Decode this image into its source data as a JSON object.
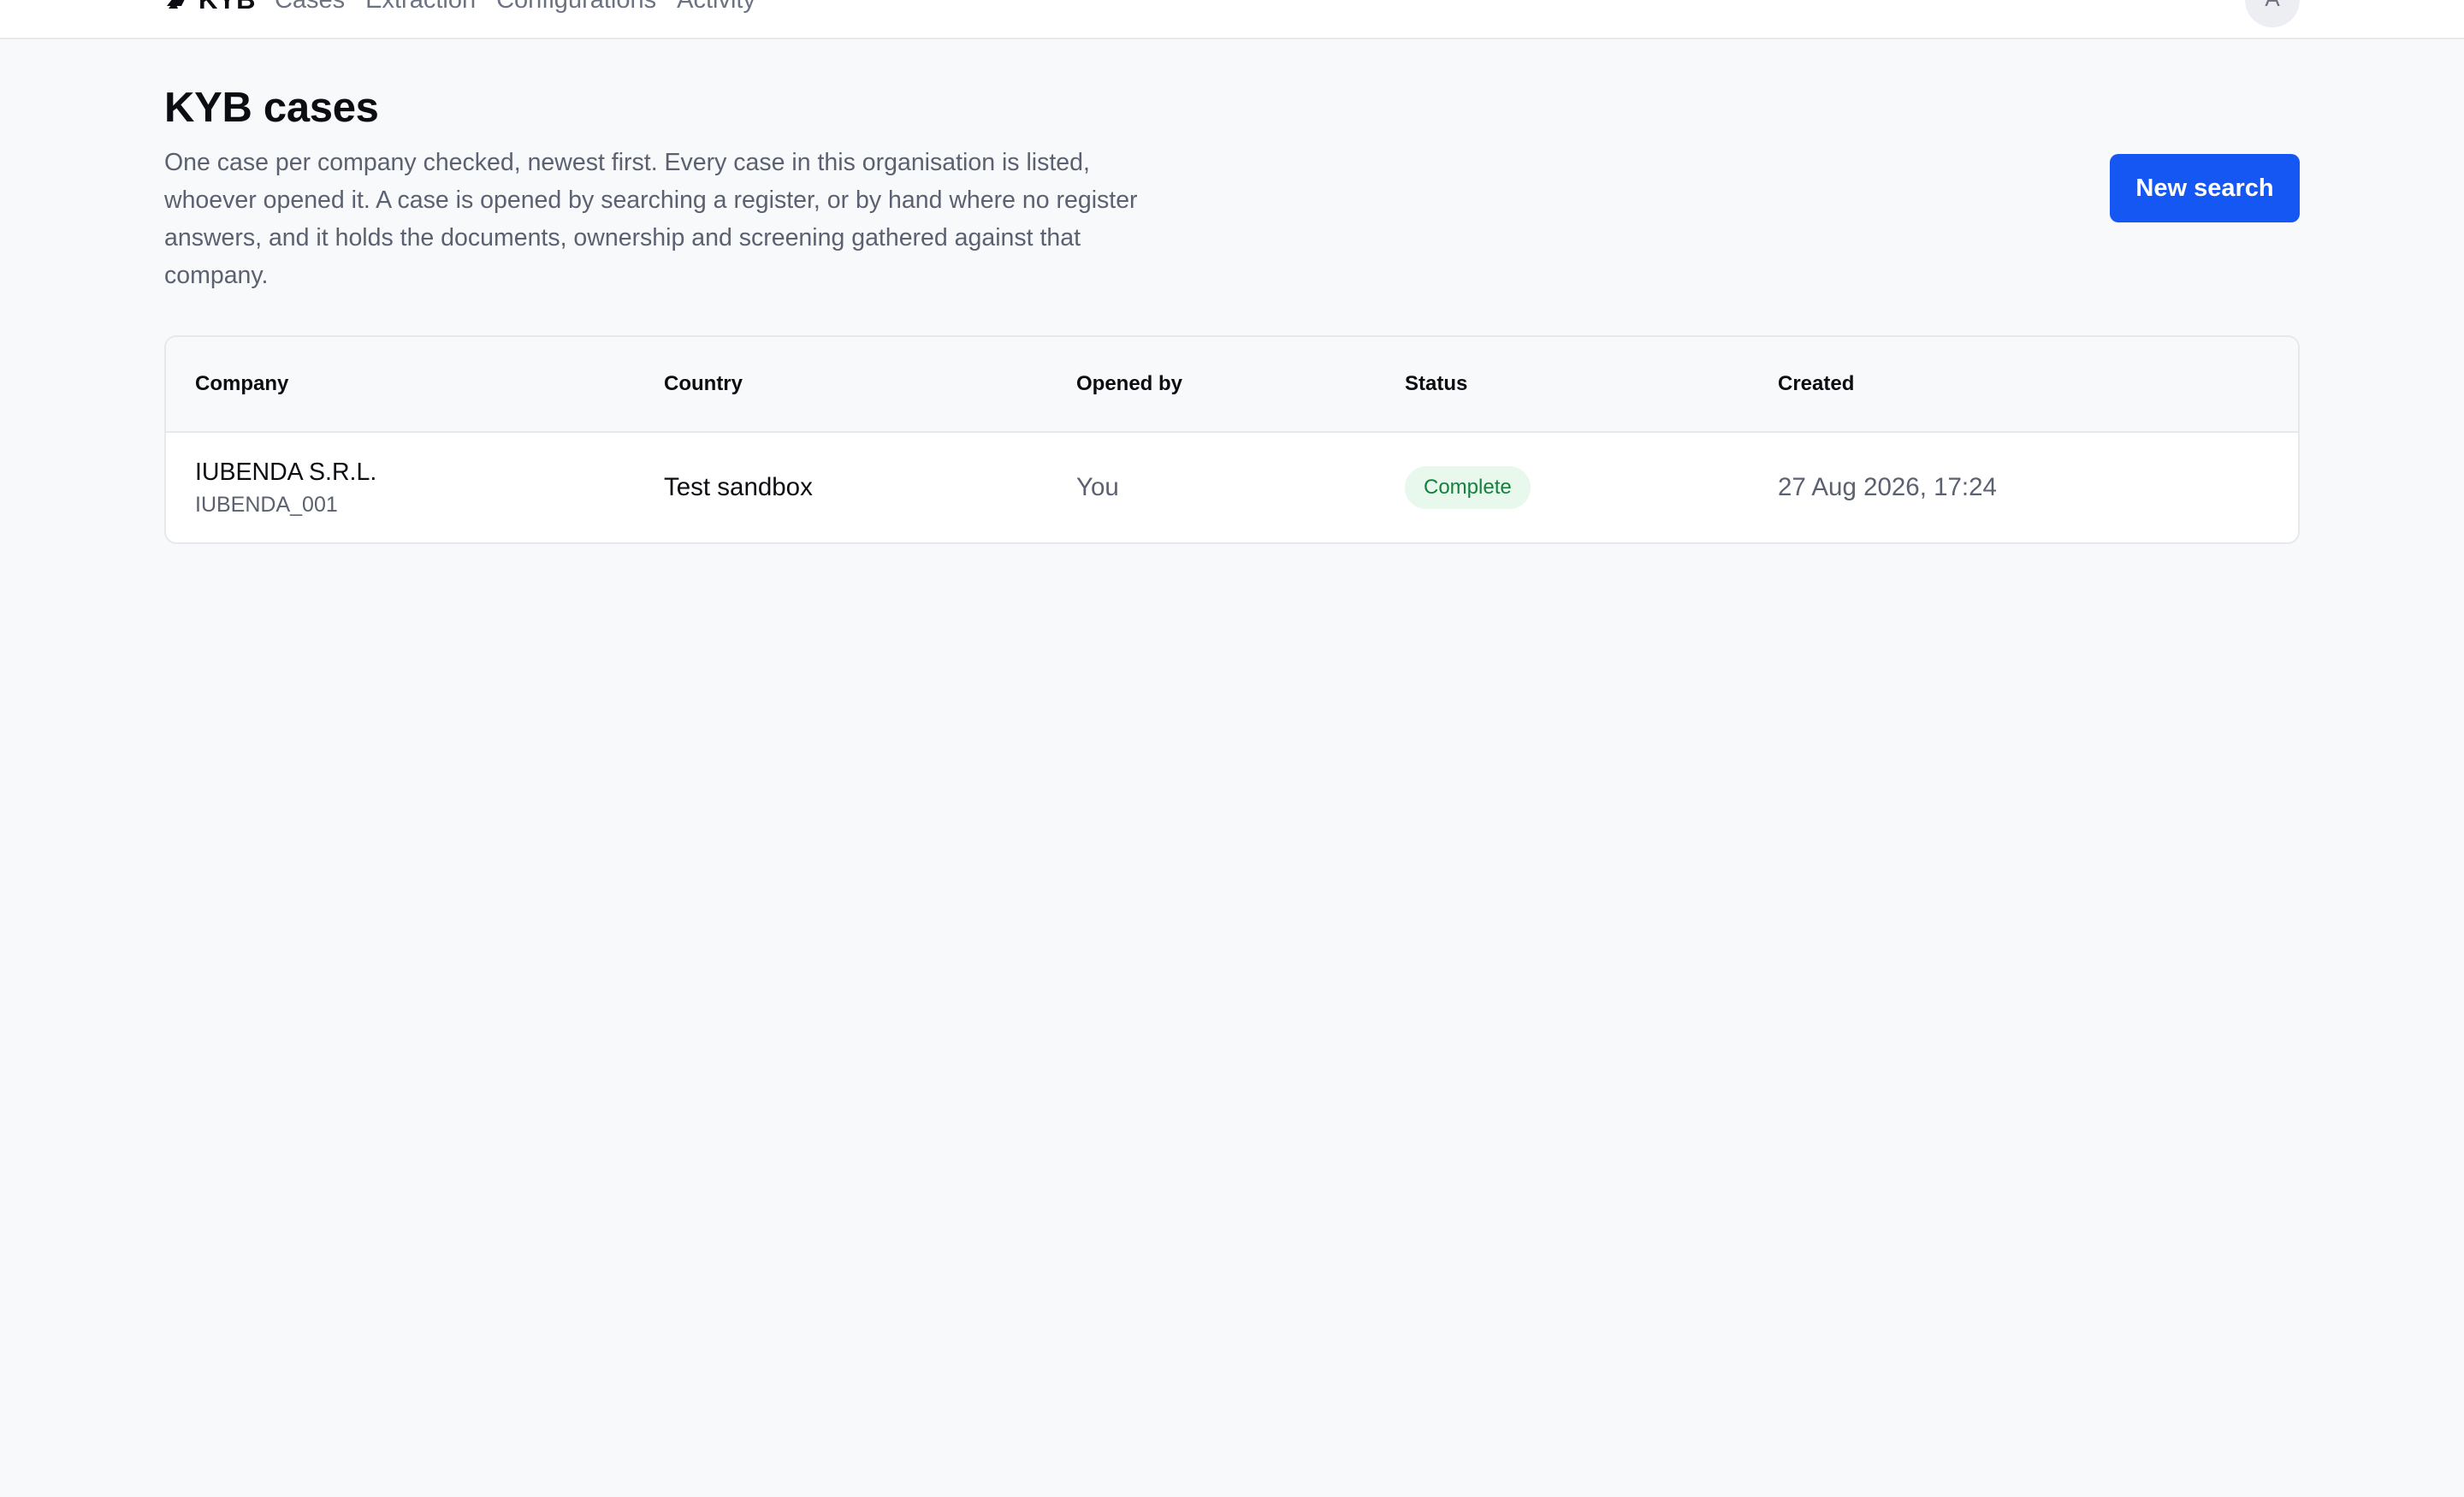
{
  "nav": {
    "brand": "KYB",
    "links": [
      "Cases",
      "Extraction",
      "Configurations",
      "Activity"
    ],
    "avatar_initial": "A"
  },
  "header": {
    "title": "KYB cases",
    "description": "One case per company checked, newest first. Every case in this organisation is listed, whoever opened it. A case is opened by searching a register, or by hand where no register answers, and it holds the documents, ownership and screening gathered against that company.",
    "new_search_label": "New search"
  },
  "table": {
    "columns": [
      "Company",
      "Country",
      "Opened by",
      "Status",
      "Created"
    ],
    "rows": [
      {
        "company": "IUBENDA S.R.L.",
        "company_id": "IUBENDA_001",
        "country": "Test sandbox",
        "opened_by": "You",
        "status": "Complete",
        "created": "27 Aug 2026, 17:24"
      }
    ]
  },
  "colors": {
    "accent": "#1557f2",
    "status_complete_bg": "#e8f8ec",
    "status_complete_text": "#15803d"
  },
  "icons": {
    "brand_logo": "kyb-logo-icon"
  }
}
